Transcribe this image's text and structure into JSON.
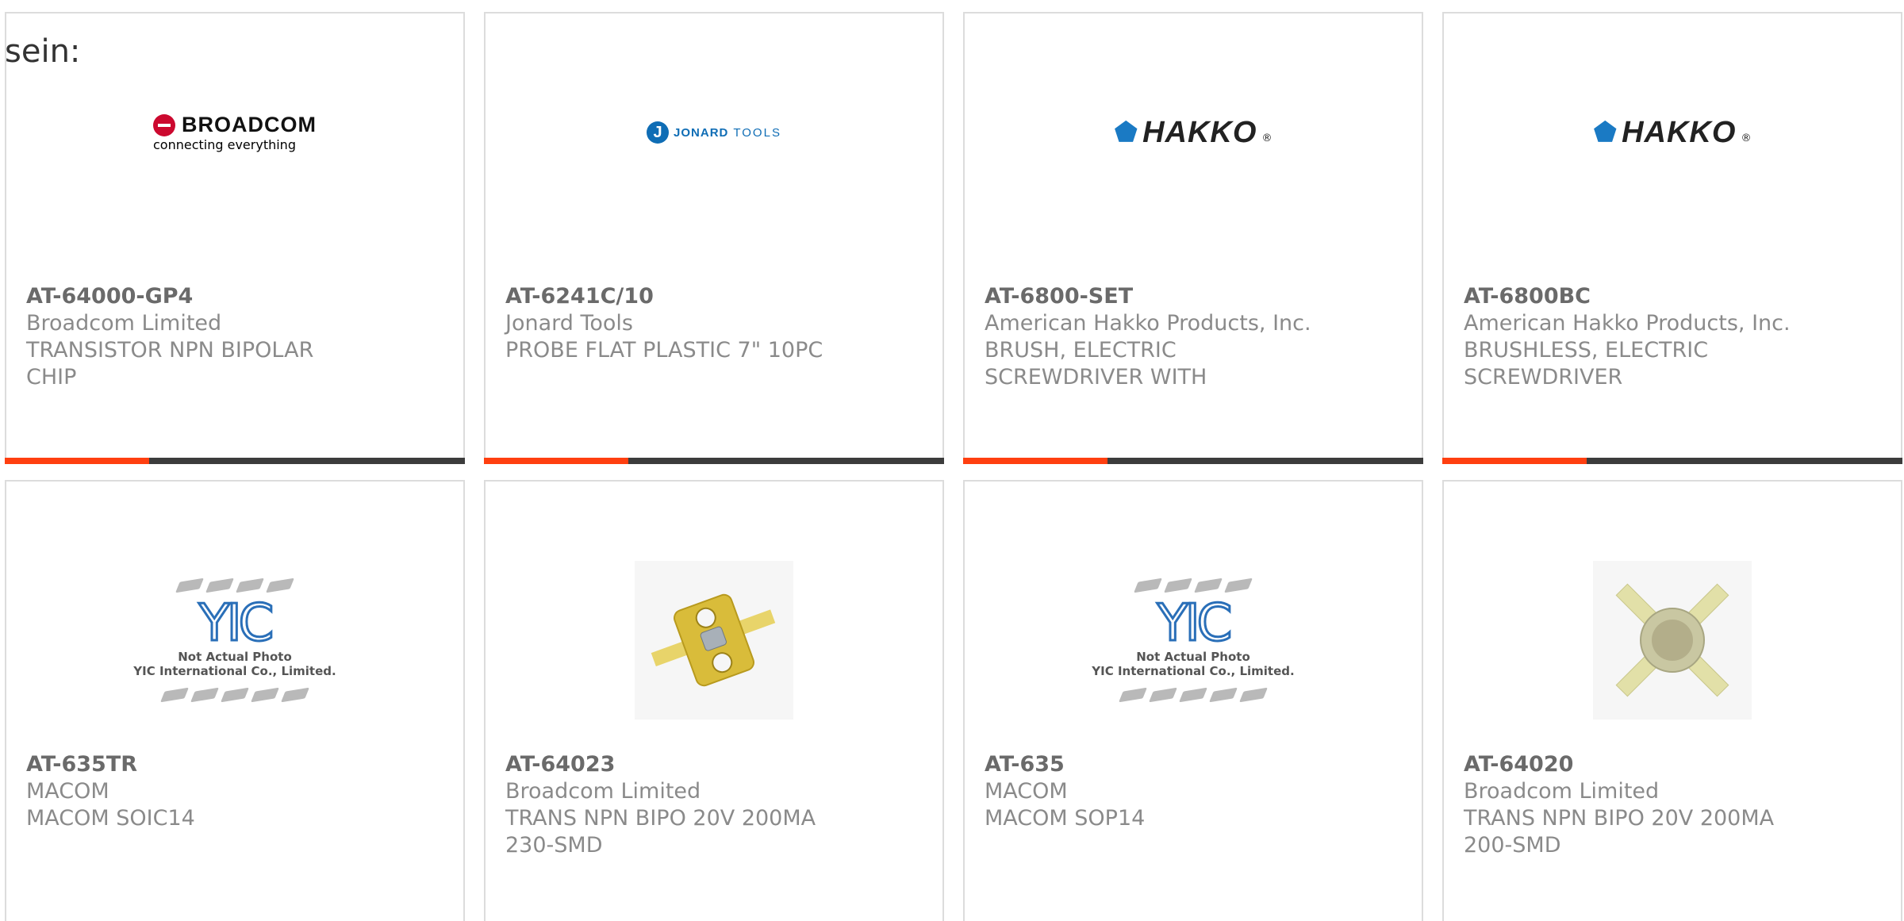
{
  "heading": "sein:",
  "products": [
    {
      "part": "AT-64000-GP4",
      "maker": "Broadcom Limited",
      "desc": "TRANSISTOR NPN BIPOLAR CHIP",
      "image": "broadcom-logo"
    },
    {
      "part": "AT-6241C/10",
      "maker": "Jonard Tools",
      "desc": "PROBE FLAT PLASTIC 7\" 10PC",
      "image": "jonard-tools-logo"
    },
    {
      "part": "AT-6800-SET",
      "maker": "American Hakko Products, Inc.",
      "desc": "BRUSH, ELECTRIC SCREWDRIVER WITH",
      "image": "hakko-logo"
    },
    {
      "part": "AT-6800BC",
      "maker": "American Hakko Products, Inc.",
      "desc": "BRUSHLESS, ELECTRIC SCREWDRIVER",
      "image": "hakko-logo"
    },
    {
      "part": "AT-635TR",
      "maker": "MACOM",
      "desc": "MACOM SOIC14",
      "image": "yic-placeholder"
    },
    {
      "part": "AT-64023",
      "maker": "Broadcom Limited",
      "desc": "TRANS NPN BIPO 20V 200MA 230-SMD",
      "image": "transistor-flange-photo"
    },
    {
      "part": "AT-635",
      "maker": "MACOM",
      "desc": "MACOM SOP14",
      "image": "yic-placeholder"
    },
    {
      "part": "AT-64020",
      "maker": "Broadcom Limited",
      "desc": "TRANS NPN BIPO 20V 200MA 200-SMD",
      "image": "transistor-cross-photo"
    }
  ],
  "logos": {
    "broadcom": {
      "word": "BROADCOM",
      "tagline": "connecting everything"
    },
    "jonard": {
      "mark": "J",
      "word1": "JONARD",
      "word2": "TOOLS"
    },
    "hakko": {
      "word": "HAKKO",
      "reg": "®"
    }
  },
  "yic": {
    "logo": "YIC",
    "caption_line1": "Not Actual Photo",
    "caption_line2": "YIC International Co., Limited."
  },
  "colors": {
    "accent": "#ff3f10",
    "bar": "#3c3c3c",
    "border": "#dcdcdc",
    "text": "#8a8a8a"
  }
}
